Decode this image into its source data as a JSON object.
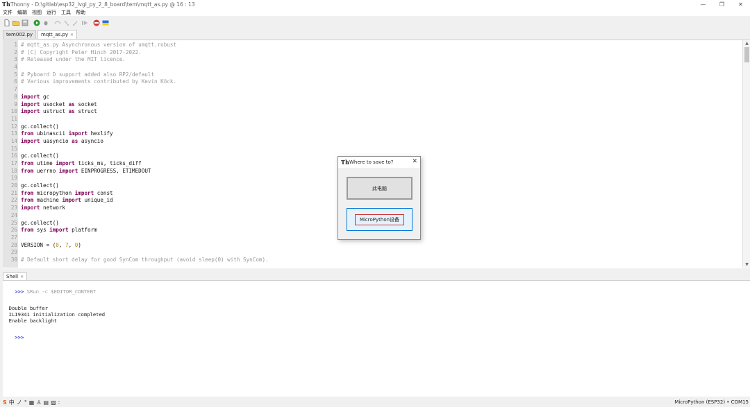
{
  "window": {
    "title": "Thonny  -  D:\\gitlab\\esp32_lvgl_py_2_8_board\\tem\\mqtt_as.py  @  16 : 13",
    "controls": [
      "—",
      "❐",
      "✕"
    ]
  },
  "menu": [
    "文件",
    "编辑",
    "视图",
    "运行",
    "工具",
    "帮助"
  ],
  "toolbar": {
    "icons": [
      "new-file-icon",
      "open-file-icon",
      "save-icon",
      "run-icon",
      "debug-icon",
      "step-over-icon",
      "step-into-icon",
      "step-out-icon",
      "resume-icon",
      "stop-icon",
      "flag-icon"
    ]
  },
  "editor": {
    "tabs": [
      {
        "label": "tem002.py",
        "active": false
      },
      {
        "label": "mqtt_as.py",
        "active": true
      }
    ],
    "lines": [
      "# mqtt_as.py Asynchronous version of umqtt.robust",
      "# (C) Copyright Peter Hinch 2017-2022.",
      "# Released under the MIT licence.",
      "",
      "# Pyboard D support added also RP2/default",
      "# Various improvements contributed by Kevin Köck.",
      "",
      "import gc",
      "import usocket as socket",
      "import ustruct as struct",
      "",
      "gc.collect()",
      "from ubinascii import hexlify",
      "import uasyncio as asyncio",
      "",
      "gc.collect()",
      "from utime import ticks_ms, ticks_diff",
      "from uerrno import EINPROGRESS, ETIMEDOUT",
      "",
      "gc.collect()",
      "from micropython import const",
      "from machine import unique_id",
      "import network",
      "",
      "gc.collect()",
      "from sys import platform",
      "",
      "VERSION = (0, 7, 0)",
      "",
      "# Default short delay for good SynCom throughput (avoid sleep(0) with SynCom)."
    ]
  },
  "shell": {
    "tab_label": "Shell",
    "prompt": ">>>",
    "command": " %Run -c $EDITOR_CONTENT",
    "output": [
      "  Double buffer",
      "  ILI9341 initialization completed",
      "  Enable backlight"
    ]
  },
  "dialog": {
    "title": "Where to save to?",
    "close": "✕",
    "option_computer": "此电脑",
    "option_device": "MicroPython设备"
  },
  "status": {
    "interpreter": "MicroPython (ESP32)  •  COM15",
    "ime": [
      "中",
      "ノ",
      "°",
      "▦",
      "♙",
      "▤",
      "▨",
      ":"
    ]
  }
}
